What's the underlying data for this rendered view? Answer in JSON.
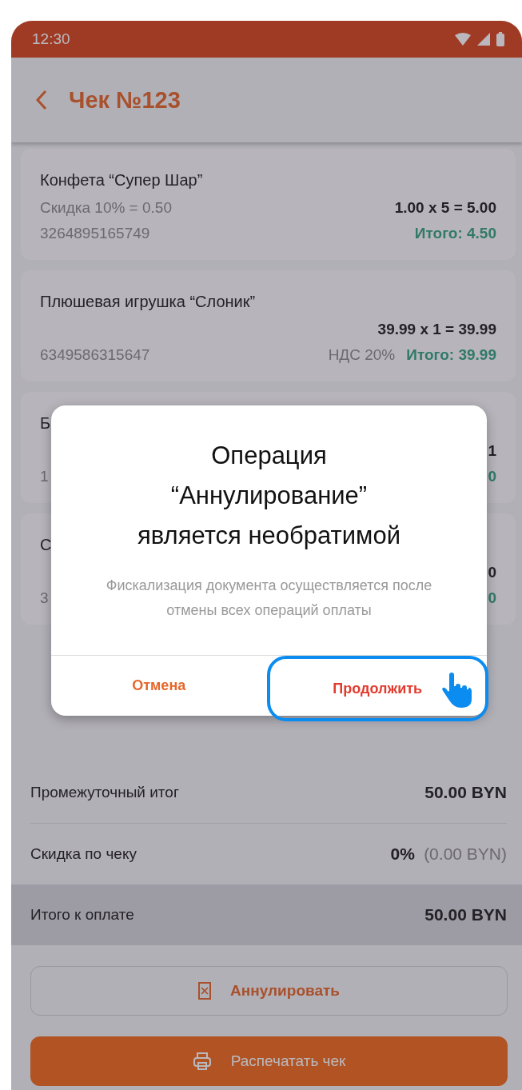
{
  "status_bar": {
    "time": "12:30"
  },
  "app_bar": {
    "title": "Чек №123"
  },
  "items": [
    {
      "name": "Конфета “Супер Шар”",
      "discount": "Скидка 10% = 0.50",
      "price": "1.00 x 5 = 5.00",
      "code": "3264895165749",
      "total": "Итого: 4.50"
    },
    {
      "name": "Плюшевая игрушка “Слоник”",
      "price": "39.99 x 1 = 39.99",
      "code": "6349586315647",
      "vat": "НДС 20%",
      "total": "Итого: 39.99"
    },
    {
      "name": "Б",
      "price": "1",
      "code": "1",
      "total": "0"
    },
    {
      "name": "С",
      "price": "0",
      "code": "3",
      "total": "0"
    }
  ],
  "summary": [
    {
      "label": "Промежуточный итог",
      "value": "50.00 BYN",
      "highlighted": false
    },
    {
      "label": "Скидка по чеку",
      "value": "0%",
      "note": "(0.00 BYN)",
      "highlighted": false
    },
    {
      "label": "Итого к оплате",
      "value": "50.00 BYN",
      "highlighted": true
    }
  ],
  "actions": [
    {
      "kind": "outline",
      "label": "Аннулировать"
    },
    {
      "kind": "filled",
      "label": "Распечатать чек"
    }
  ],
  "dialog": {
    "title": "Операция “Аннулирование” является необратимой",
    "message": "Фискализация документа осуществляется после отмены всех операций оплаты",
    "buttons": [
      {
        "label": "Отмена",
        "highlighted": false
      },
      {
        "label": "Продолжить",
        "highlighted": true
      }
    ]
  }
}
